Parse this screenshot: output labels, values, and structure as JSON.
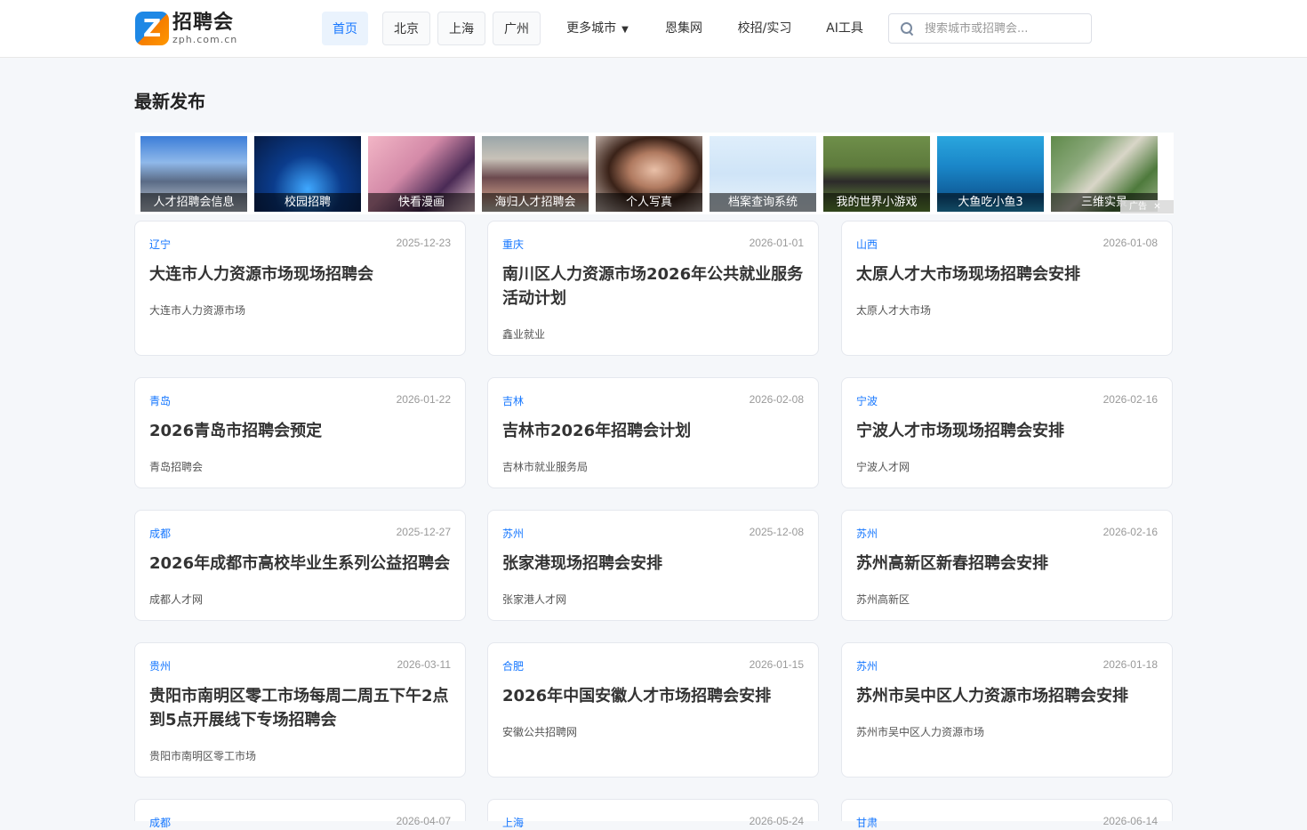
{
  "header": {
    "logo_cn": "招聘会",
    "logo_en": "zph.com.cn",
    "logo_letter": "Z",
    "nav": [
      {
        "label": "首页"
      },
      {
        "label": "北京"
      },
      {
        "label": "上海"
      },
      {
        "label": "广州"
      },
      {
        "label": "更多城市"
      },
      {
        "label": "恩集网"
      },
      {
        "label": "校招/实习"
      },
      {
        "label": "AI工具"
      }
    ],
    "more_caret": "▼",
    "search_placeholder": "搜索城市或招聘会..."
  },
  "section": {
    "title": "最新发布"
  },
  "ads": {
    "tiles": [
      {
        "label": "人才招聘会信息"
      },
      {
        "label": "校园招聘"
      },
      {
        "label": "快看漫画"
      },
      {
        "label": "海归人才招聘会"
      },
      {
        "label": "个人写真"
      },
      {
        "label": "档案查询系统"
      },
      {
        "label": "我的世界小游戏"
      },
      {
        "label": "大鱼吃小鱼3"
      },
      {
        "label": "三维实景"
      }
    ],
    "badge": "广告",
    "close": "✕"
  },
  "cards": [
    {
      "region": "辽宁",
      "date": "2025-12-23",
      "title": "大连市人力资源市场现场招聘会",
      "source": "大连市人力资源市场"
    },
    {
      "region": "重庆",
      "date": "2026-01-01",
      "title": "南川区人力资源市场2026年公共就业服务活动计划",
      "source": "鑫业就业"
    },
    {
      "region": "山西",
      "date": "2026-01-08",
      "title": "太原人才大市场现场招聘会安排",
      "source": "太原人才大市场"
    },
    {
      "region": "青岛",
      "date": "2026-01-22",
      "title": "2026青岛市招聘会预定",
      "source": "青岛招聘会"
    },
    {
      "region": "吉林",
      "date": "2026-02-08",
      "title": "吉林市2026年招聘会计划",
      "source": "吉林市就业服务局"
    },
    {
      "region": "宁波",
      "date": "2026-02-16",
      "title": "宁波人才市场现场招聘会安排",
      "source": "宁波人才网"
    },
    {
      "region": "成都",
      "date": "2025-12-27",
      "title": "2026年成都市高校毕业生系列公益招聘会",
      "source": "成都人才网"
    },
    {
      "region": "苏州",
      "date": "2025-12-08",
      "title": "张家港现场招聘会安排",
      "source": "张家港人才网"
    },
    {
      "region": "苏州",
      "date": "2026-02-16",
      "title": "苏州高新区新春招聘会安排",
      "source": "苏州高新区"
    },
    {
      "region": "贵州",
      "date": "2026-03-11",
      "title": "贵阳市南明区零工市场每周二周五下午2点到5点开展线下专场招聘会",
      "source": "贵阳市南明区零工市场"
    },
    {
      "region": "合肥",
      "date": "2026-01-15",
      "title": "2026年中国安徽人才市场招聘会安排",
      "source": "安徽公共招聘网"
    },
    {
      "region": "苏州",
      "date": "2026-01-18",
      "title": "苏州市吴中区人力资源市场招聘会安排",
      "source": "苏州市吴中区人力资源市场"
    },
    {
      "region": "成都",
      "date": "2026-04-07",
      "title": "",
      "source": ""
    },
    {
      "region": "上海",
      "date": "2026-05-24",
      "title": "",
      "source": ""
    },
    {
      "region": "甘肃",
      "date": "2026-06-14",
      "title": "",
      "source": ""
    }
  ]
}
